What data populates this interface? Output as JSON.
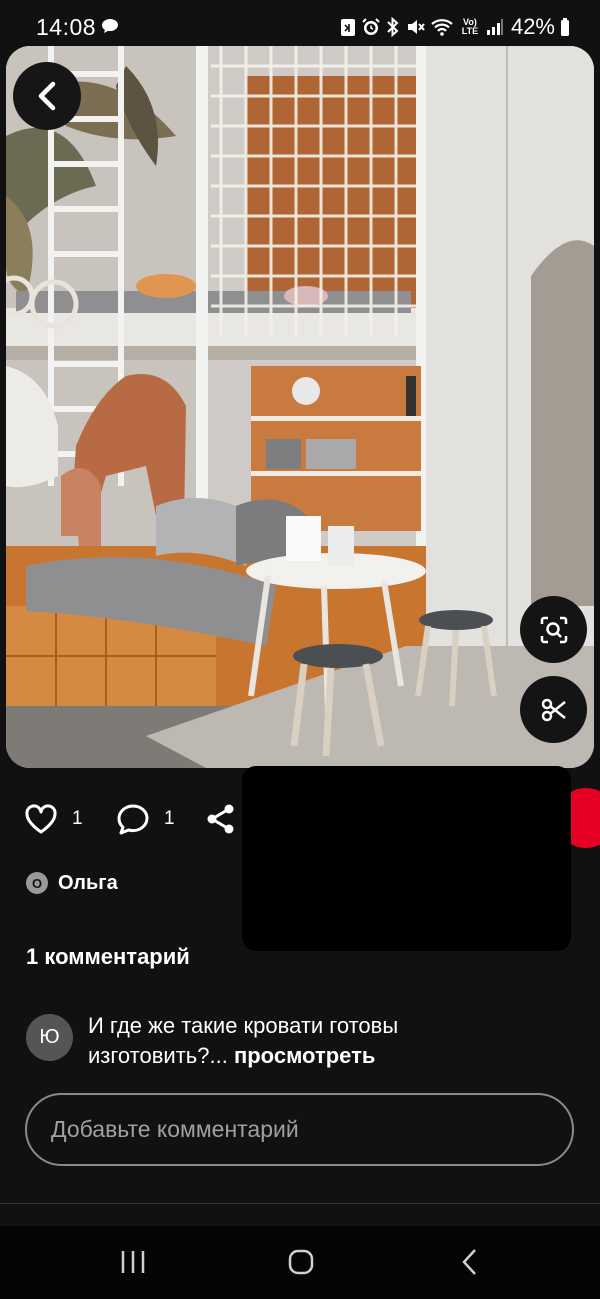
{
  "status_bar": {
    "time": "14:08",
    "battery": "42%",
    "network_label": "Vo) LTE",
    "icons": [
      "message-icon",
      "nfc-icon",
      "alarm-icon",
      "bluetooth-icon",
      "mute-icon",
      "wifi-icon",
      "signal-icon",
      "battery-icon"
    ]
  },
  "pin": {
    "image_alt": "Детская комната с двухъярусной кроватью, сеткой и лестницей",
    "back_icon": "chevron-left-icon",
    "lens_icon": "visual-search-icon",
    "cut_icon": "scissors-icon"
  },
  "actions": {
    "likes": "1",
    "comments": "1",
    "share_icon": "share-icon"
  },
  "author": {
    "initial": "О",
    "name": "Ольга"
  },
  "comments": {
    "heading": "1 комментарий",
    "items": [
      {
        "avatar_initial": "Ю",
        "text": "И где же такие кровати готовы изготовить?...",
        "more": "просмотреть"
      }
    ]
  },
  "input": {
    "placeholder": "Добавьте комментарий"
  },
  "colors": {
    "background": "#111111",
    "accent": "#e60023",
    "nav_bar": "#050505"
  }
}
